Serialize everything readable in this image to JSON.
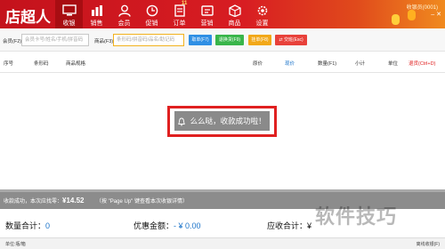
{
  "app": {
    "logo": "店超人"
  },
  "nav": [
    {
      "label": "收银",
      "icon": "monitor-icon",
      "active": true
    },
    {
      "label": "销售",
      "icon": "bar-chart-icon",
      "active": false
    },
    {
      "label": "会员",
      "icon": "user-icon",
      "active": false
    },
    {
      "label": "促销",
      "icon": "clock-icon",
      "active": false
    },
    {
      "label": "订单",
      "icon": "order-list-icon",
      "active": false,
      "badge": "11"
    },
    {
      "label": "营销",
      "icon": "marketing-icon",
      "active": false
    },
    {
      "label": "商品",
      "icon": "box-icon",
      "active": false
    },
    {
      "label": "设置",
      "icon": "gear-icon",
      "active": false
    }
  ],
  "topbar": {
    "user_text": "收银员(0001)",
    "colors": {
      "start": "#c4121c",
      "end": "#f08a1e"
    }
  },
  "toolbar": {
    "member_label": "会员(F2)",
    "member_placeholder": "会员卡号/姓名/手机/拼音码",
    "product_label": "商品(F3)",
    "product_placeholder": "条形码/拼音码/品名/助记码",
    "buttons": [
      {
        "label": "取单(F7)",
        "color": "#2f8fe4"
      },
      {
        "label": "退换货(F9)",
        "color": "#39b54a"
      },
      {
        "label": "挂单(F8)",
        "color": "#f2a818"
      },
      {
        "label": "交班(Esc)",
        "color": "#e8413a",
        "icon": "swap-icon"
      }
    ]
  },
  "table": {
    "columns": [
      "序号",
      "条形码",
      "商品规格",
      "原价",
      "现价",
      "数量(F1)",
      "小计",
      "单位",
      "退货(Ctrl+D)"
    ],
    "rows": []
  },
  "toast": {
    "message": "么么哒，收款成功啦！",
    "icon": "bell-icon"
  },
  "status": {
    "prefix": "收款成功，本次应找零：",
    "amount": "¥14.52",
    "hint": "（按 \"Page Up\" 键查看本次收银详情）"
  },
  "totals": {
    "qty_label": "数量合计：",
    "qty_value": "0",
    "discount_label": "优惠金额：",
    "discount_value": "- ¥ 0.00",
    "receivable_label": "应收合计：",
    "receivable_value": "¥"
  },
  "footer": {
    "left": "单位:瓶/箱",
    "right": "离线收银(F)"
  },
  "watermark": "软件技巧"
}
